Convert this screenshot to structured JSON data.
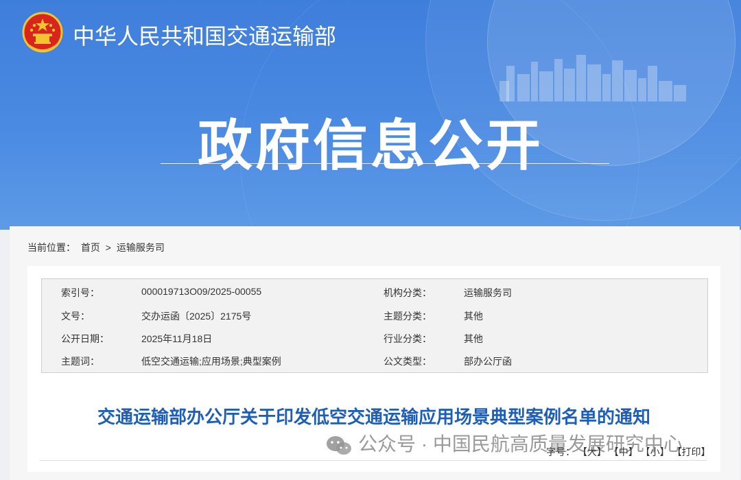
{
  "header": {
    "ministry_name": "中华人民共和国交通运输部",
    "section_title": "政府信息公开"
  },
  "breadcrumb": {
    "label": "当前位置：",
    "home": "首页",
    "separator": ">",
    "current": "运输服务司"
  },
  "meta": {
    "rows": [
      {
        "label1": "索引号：",
        "value1": "000019713O09/2025-00055",
        "label2": "机构分类：",
        "value2": "运输服务司"
      },
      {
        "label1": "文号：",
        "value1": "交办运函〔2025〕2175号",
        "label2": "主题分类：",
        "value2": "其他"
      },
      {
        "label1": "公开日期：",
        "value1": "2025年11月18日",
        "label2": "行业分类：",
        "value2": "其他"
      },
      {
        "label1": "主题词：",
        "value1": "低空交通运输;应用场景;典型案例",
        "label2": "公文类型：",
        "value2": "部办公厅函"
      }
    ]
  },
  "document": {
    "title": "交通运输部办公厅关于印发低空交通运输应用场景典型案例名单的通知"
  },
  "watermark": {
    "text": "公众号 · 中国民航高质量发展研究中心",
    "icon": "wechat-icon"
  },
  "font_size": {
    "label": "字号：",
    "large": "【大】",
    "medium": "【中】",
    "small": "【小】",
    "print": "【打印】"
  },
  "colors": {
    "banner": "#4a8ae2",
    "title_blue": "#1d5fb8"
  }
}
